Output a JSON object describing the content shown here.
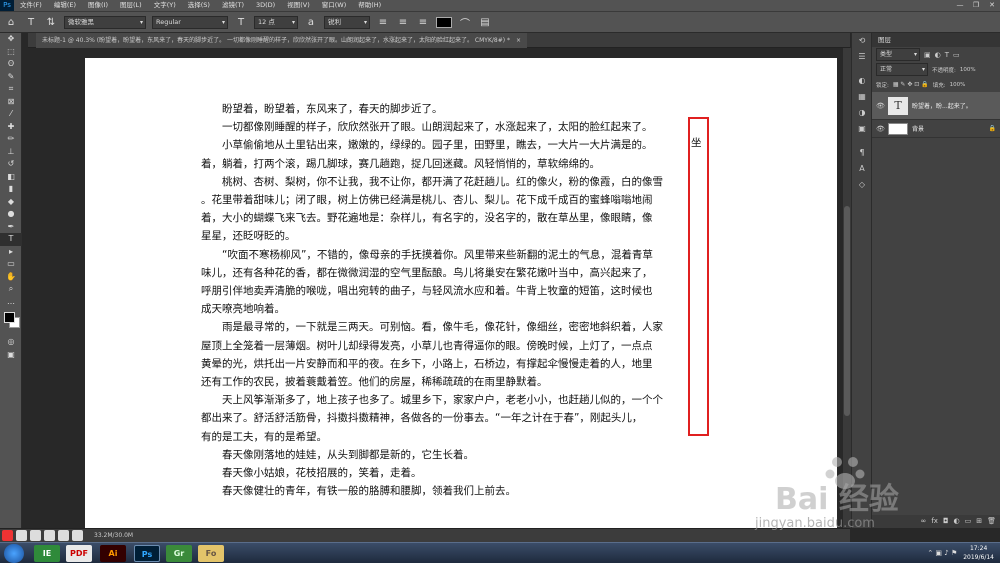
{
  "menubar": {
    "app_icon": "Ps",
    "items": [
      "文件(F)",
      "编辑(E)",
      "图像(I)",
      "图层(L)",
      "文字(Y)",
      "选择(S)",
      "滤镜(T)",
      "3D(D)",
      "视图(V)",
      "窗口(W)",
      "帮助(H)"
    ],
    "window_controls": [
      "—",
      "❐",
      "✕"
    ]
  },
  "options": {
    "font_family": "微软雅黑",
    "font_style": "Regular",
    "font_size": "12 点",
    "antialias": "锐利",
    "text_color": "#000000"
  },
  "tab": {
    "title": "未标题-1 @ 40.3% (盼望着，盼望着，东风来了，春天的脚步近了。 一切都像刚睡醒的样子，欣欣然张开了眼。山朗润起来了，水涨起来了，太阳的脸红起来了。 CMYK/8#) *",
    "close": "×"
  },
  "document": {
    "paragraphs": [
      "盼望着，盼望着，东风来了，春天的脚步近了。",
      "一切都像刚睡醒的样子，欣欣然张开了眼。山朗润起来了，水涨起来了，太阳的脸红起来了。",
      "小草偷偷地从土里钻出来，嫩嫩的，绿绿的。园子里，田野里，瞧去，一大片一大片满是的。",
      "着，躺着，打两个滚，踢几脚球，赛几趟跑，捉几回迷藏。风轻悄悄的，草软绵绵的。",
      "桃树、杏树、梨树，你不让我，我不让你，都开满了花赶趟儿。红的像火，粉的像霞，白的像雪",
      "。花里带着甜味儿；闭了眼，树上仿佛已经满是桃儿、杏儿、梨儿。花下成千成百的蜜蜂嗡嗡地闹",
      "着，大小的蝴蝶飞来飞去。野花遍地是：杂样儿，有名字的，没名字的，散在草丛里，像眼睛，像",
      "星星，还眨呀眨的。",
      "“吹面不寒杨柳风”，不错的，像母亲的手抚摸着你。风里带来些新翻的泥土的气息，混着青草",
      "味儿，还有各种花的香，都在微微润湿的空气里酝酿。鸟儿将巢安在繁花嫩叶当中，高兴起来了，",
      "呼朋引伴地卖弄清脆的喉咙，唱出宛转的曲子，与轻风流水应和着。牛背上牧童的短笛，这时候也",
      "成天嘹亮地响着。",
      "雨是最寻常的，一下就是三两天。可别恼。看，像牛毛，像花针，像细丝，密密地斜织着，人家",
      "屋顶上全笼着一层薄烟。树叶儿却绿得发亮，小草儿也青得逼你的眼。傍晚时候，上灯了，一点点",
      "黄晕的光，烘托出一片安静而和平的夜。在乡下，小路上，石桥边，有撑起伞慢慢走着的人，地里",
      "还有工作的农民，披着蓑戴着笠。他们的房屋，稀稀疏疏的在雨里静默着。",
      "天上风筝渐渐多了，地上孩子也多了。城里乡下，家家户户，老老小小，也赶趟儿似的，一个个",
      "都出来了。舒活舒活筋骨，抖擞抖擞精神，各做各的一份事去。“一年之计在于春”，刚起头儿，",
      "有的是工夫，有的是希望。",
      "春天像刚落地的娃娃，从头到脚都是新的，它生长着。",
      "春天像小姑娘，花枝招展的，笑着，走着。",
      "春天像健壮的青年，有铁一般的胳膊和腰脚，领着我们上前去。"
    ],
    "highlight_char": "坐"
  },
  "layers_panel": {
    "title": "图层",
    "kind_label": "类型",
    "blend_mode": "正常",
    "opacity_label": "不透明度:",
    "opacity_value": "100%",
    "lock_label": "锁定:",
    "fill_label": "填充:",
    "fill_value": "100%",
    "layers": [
      {
        "name": "盼望着，盼...起来了。",
        "type": "text"
      },
      {
        "name": "背景",
        "type": "background"
      }
    ]
  },
  "status": {
    "doc_size": "33.2M/30.0M"
  },
  "taskbar": {
    "apps": [
      "IE",
      "PDF",
      "Ai",
      "Ps",
      "Gr",
      "Fo"
    ],
    "time": "17:24",
    "date": "2019/6/14"
  },
  "watermark": {
    "text": "Bai 经验",
    "url": "jingyan.baidu.com"
  }
}
